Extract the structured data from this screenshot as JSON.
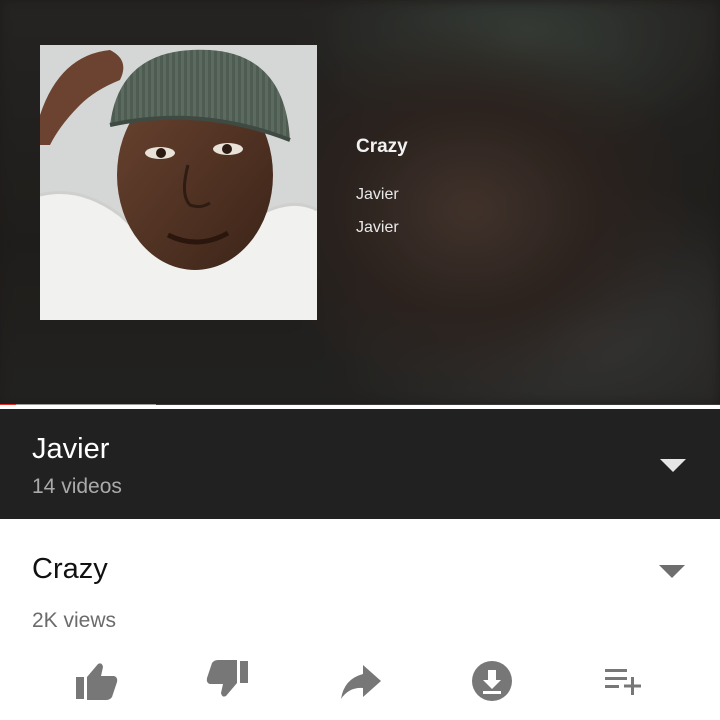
{
  "player": {
    "card": {
      "title": "Crazy",
      "artist_line_1": "Javier",
      "artist_line_2": "Javier"
    },
    "progress": {
      "played_fraction": 0.022,
      "buffered_fraction": 0.217
    },
    "colors": {
      "played": "#e52d27",
      "buffered": "#9a9a9a"
    }
  },
  "playlist": {
    "title": "Javier",
    "count": "14 videos",
    "expand_icon": "caret-down-icon"
  },
  "video": {
    "title": "Crazy",
    "views": "2K views",
    "expand_icon": "caret-down-icon"
  },
  "actions": [
    {
      "icon": "thumbs-up-icon"
    },
    {
      "icon": "thumbs-down-icon"
    },
    {
      "icon": "share-icon"
    },
    {
      "icon": "download-icon"
    },
    {
      "icon": "add-to-playlist-icon"
    }
  ]
}
